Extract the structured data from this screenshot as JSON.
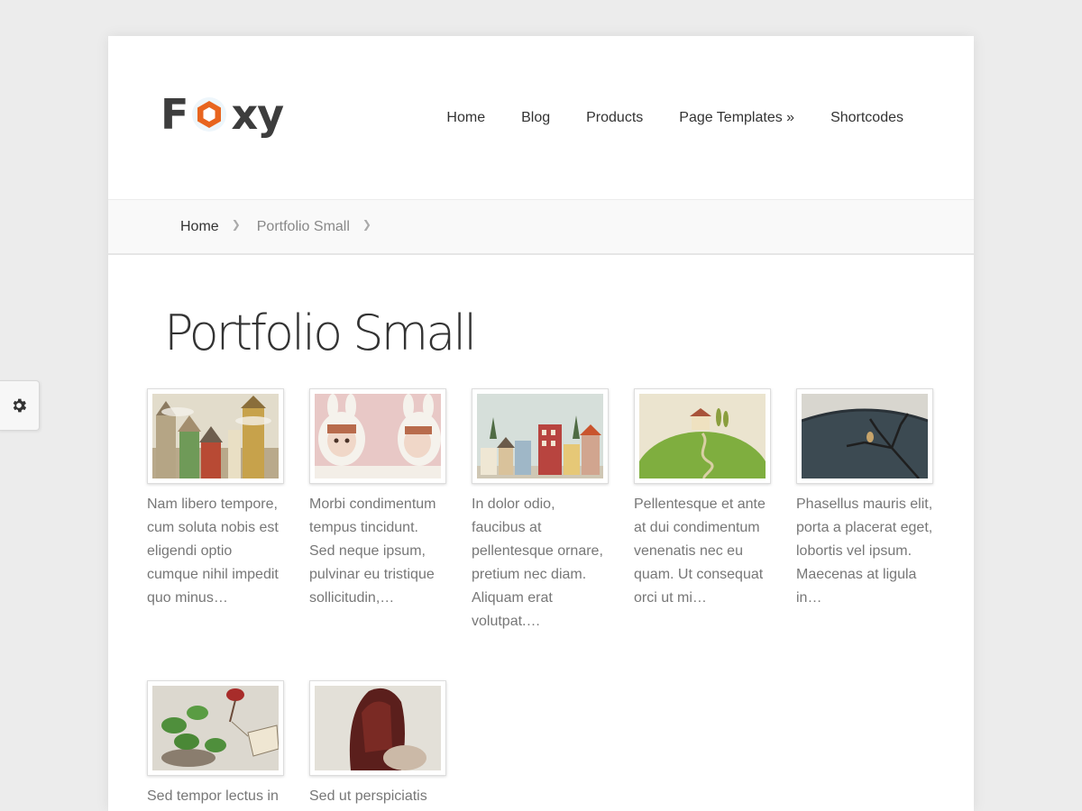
{
  "logo": {
    "prefix": "F",
    "suffix": "xy",
    "accent": "#e8651f"
  },
  "nav": {
    "items": [
      {
        "label": "Home"
      },
      {
        "label": "Blog"
      },
      {
        "label": "Products"
      },
      {
        "label": "Page Templates »"
      },
      {
        "label": "Shortcodes"
      }
    ]
  },
  "breadcrumb": {
    "home": "Home",
    "current": "Portfolio Small"
  },
  "page": {
    "title": "Portfolio Small"
  },
  "portfolio": {
    "items": [
      {
        "caption": "Nam libero tempore, cum soluta nobis est eligendi optio cumque nihil impedit quo minus…",
        "image": "houses-painting"
      },
      {
        "caption": "Morbi condimentum tempus tincidunt. Sed neque ipsum, pulvinar eu tristique sollicitudin,…",
        "image": "bunny-dolls"
      },
      {
        "caption": "In dolor odio, faucibus at pellentesque ornare, pretium nec diam. Aliquam erat volutpat.…",
        "image": "colorful-town"
      },
      {
        "caption": "Pellentesque et ante at dui condimentum venenatis nec eu quam. Ut consequat orci ut mi…",
        "image": "green-hill-house"
      },
      {
        "caption": "Phasellus mauris elit, porta a placerat eget, lobortis vel ipsum. Maecenas at ligula in…",
        "image": "dark-tree-landscape"
      },
      {
        "caption": "Sed tempor lectus in",
        "image": "plant-eat-tag"
      },
      {
        "caption": "Sed ut perspiciatis",
        "image": "red-haired-doll"
      }
    ]
  },
  "settings": {
    "icon": "gear-icon"
  }
}
